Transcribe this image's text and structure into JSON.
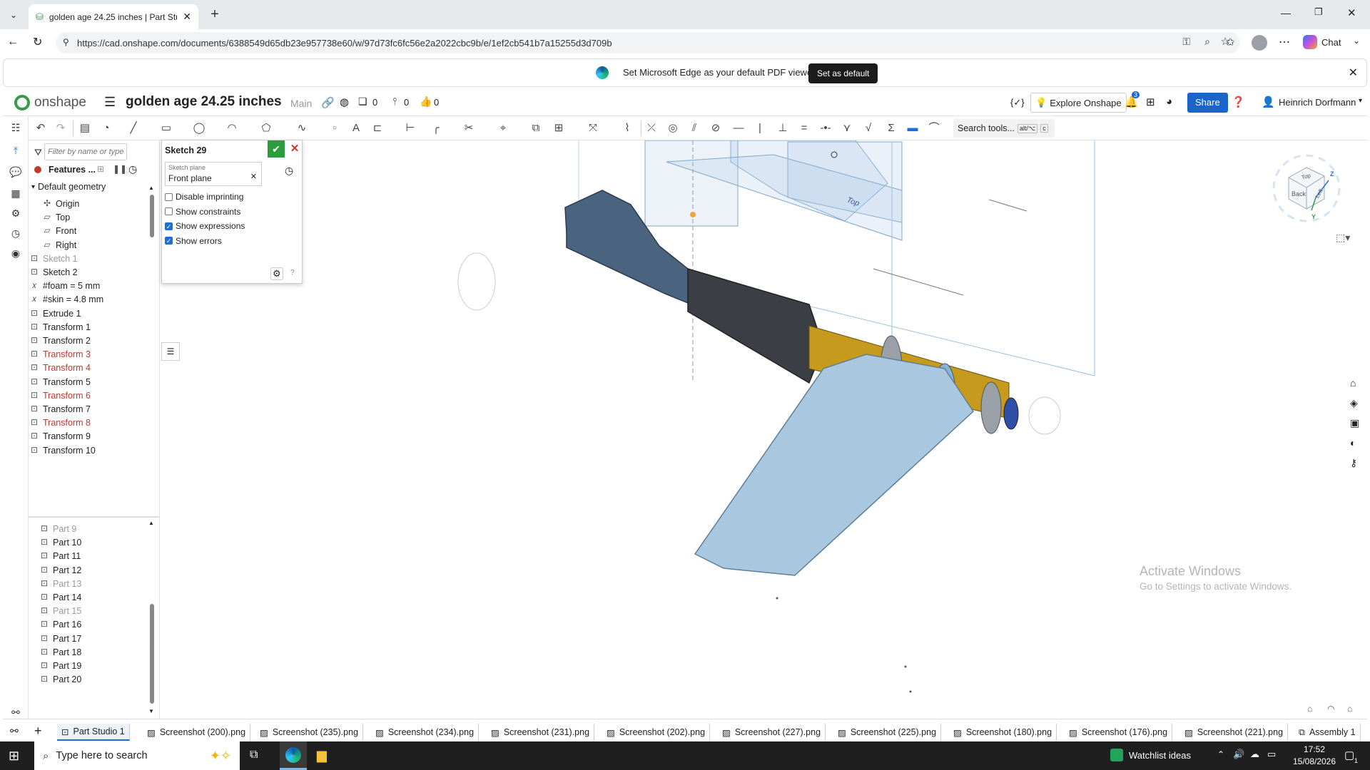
{
  "browser": {
    "tab_title": "golden age 24.25 inches | Part Stu",
    "url": "https://cad.onshape.com/documents/6388549d65db23e957738e60/w/97d73fc6fc56e2a2022cbc9b/e/1ef2cb541b7a15255d3d709b",
    "chat_label": "Chat",
    "infobar_message": "Set Microsoft Edge as your default PDF viewer",
    "infobar_button": "Set as default"
  },
  "onshape": {
    "logo": "onshape",
    "doc_title": "golden age 24.25 inches",
    "branch": "Main",
    "counter1": "0",
    "counter2": "0",
    "counter3": "0",
    "explore": "Explore Onshape",
    "notif_count": "3",
    "share": "Share",
    "user": "Heinrich Dorfmann",
    "search_tools": "Search tools...",
    "search_shortcut": "alt/⌥",
    "search_shortcut2": "c"
  },
  "tree": {
    "filter_placeholder": "Filter by name or type",
    "features_label": "Features ...",
    "default_geometry": "Default geometry",
    "items": [
      {
        "label": "Origin",
        "state": "normal"
      },
      {
        "label": "Top",
        "state": "normal"
      },
      {
        "label": "Front",
        "state": "normal"
      },
      {
        "label": "Right",
        "state": "normal"
      },
      {
        "label": "Sketch 1",
        "state": "grey"
      },
      {
        "label": "Sketch 2",
        "state": "normal"
      },
      {
        "label": "#foam = 5 mm",
        "state": "normal"
      },
      {
        "label": "#skin = 4.8 mm",
        "state": "normal"
      },
      {
        "label": "Extrude 1",
        "state": "normal"
      },
      {
        "label": "Transform 1",
        "state": "normal"
      },
      {
        "label": "Transform 2",
        "state": "normal"
      },
      {
        "label": "Transform 3",
        "state": "red"
      },
      {
        "label": "Transform 4",
        "state": "red"
      },
      {
        "label": "Transform 5",
        "state": "normal"
      },
      {
        "label": "Transform 6",
        "state": "red"
      },
      {
        "label": "Transform 7",
        "state": "normal"
      },
      {
        "label": "Transform 8",
        "state": "red"
      },
      {
        "label": "Transform 9",
        "state": "normal"
      },
      {
        "label": "Transform 10",
        "state": "normal"
      }
    ],
    "parts": [
      {
        "label": "Part 9",
        "state": "grey"
      },
      {
        "label": "Part 10",
        "state": "normal"
      },
      {
        "label": "Part 11",
        "state": "normal"
      },
      {
        "label": "Part 12",
        "state": "normal"
      },
      {
        "label": "Part 13",
        "state": "grey"
      },
      {
        "label": "Part 14",
        "state": "normal"
      },
      {
        "label": "Part 15",
        "state": "grey"
      },
      {
        "label": "Part 16",
        "state": "normal"
      },
      {
        "label": "Part 17",
        "state": "normal"
      },
      {
        "label": "Part 18",
        "state": "normal"
      },
      {
        "label": "Part 19",
        "state": "normal"
      },
      {
        "label": "Part 20",
        "state": "normal"
      }
    ]
  },
  "sketch": {
    "name": "Sketch 29",
    "plane_label": "Sketch plane",
    "plane_value": "Front plane",
    "options": [
      {
        "label": "Disable imprinting",
        "checked": false
      },
      {
        "label": "Show constraints",
        "checked": false
      },
      {
        "label": "Show expressions",
        "checked": true
      },
      {
        "label": "Show errors",
        "checked": true
      }
    ]
  },
  "viewcube": {
    "top": "Top",
    "back": "Back",
    "left": "Left",
    "axis_z": "Z",
    "axis_y": "Y"
  },
  "watermark": {
    "line1": "Activate Windows",
    "line2": "Go to Settings to activate Windows."
  },
  "doctabs": [
    "Part Studio 1",
    "Screenshot (200).png",
    "Screenshot (235).png",
    "Screenshot (234).png",
    "Screenshot (231).png",
    "Screenshot (202).png",
    "Screenshot (227).png",
    "Screenshot (225).png",
    "Screenshot (180).png",
    "Screenshot (176).png",
    "Screenshot (221).png",
    "Assembly 1"
  ],
  "taskbar": {
    "search_placeholder": "Type here to search",
    "watchlist": "Watchlist ideas",
    "time": "17:52",
    "date": "15/08/2026",
    "notif": "1"
  },
  "colors": {
    "accent": "#1d6fd6",
    "share_bg": "#1a65c7",
    "error_red": "#c0392b",
    "wing_blue": "#a9c7df",
    "fuselage_dark": "#3b3f45",
    "gold": "#c59a1d"
  }
}
